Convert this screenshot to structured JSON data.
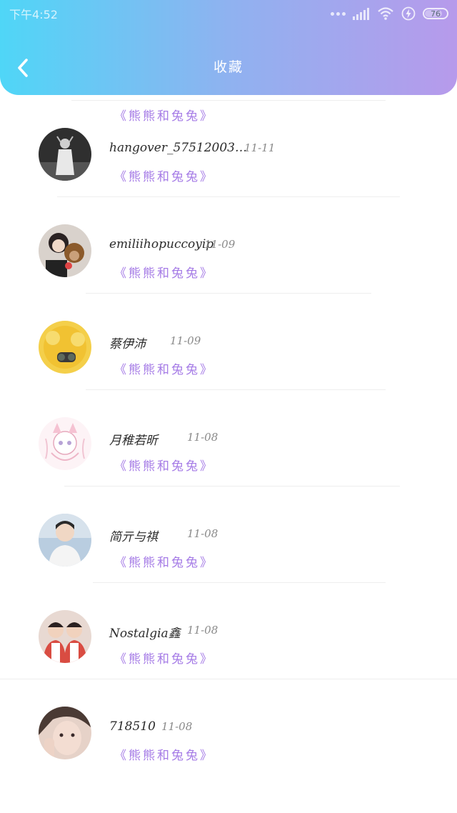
{
  "status_bar": {
    "time": "下午4:52",
    "battery": "76",
    "icons": [
      "signal-icon",
      "wifi-icon",
      "charging-icon",
      "battery-icon"
    ]
  },
  "header": {
    "title": "收藏",
    "back_icon": "chevron-left-icon",
    "gradient": [
      "#4fd6f7",
      "#b79aeb"
    ]
  },
  "tag_color": "#a57be6",
  "items": [
    {
      "name": "",
      "date": "",
      "tag": "《熊熊和兔兔》",
      "avatar_color": "#e8dccb"
    },
    {
      "name": "hangover_57512003…",
      "date": "11-11",
      "tag": "《熊熊和兔兔》",
      "avatar_color": "#3b3b3b"
    },
    {
      "name": "emiliihopuccoyip",
      "date": "11-09",
      "tag": "《熊熊和兔兔》",
      "avatar_color": "#5a4a44"
    },
    {
      "name": "蔡伊沛",
      "date": "11-09",
      "tag": "《熊熊和兔兔》",
      "avatar_color": "#f0c43c"
    },
    {
      "name": "月稚若昕",
      "date": "11-08",
      "tag": "《熊熊和兔兔》",
      "avatar_color": "#fbe7ee"
    },
    {
      "name": "简亓与祺",
      "date": "11-08",
      "tag": "《熊熊和兔兔》",
      "avatar_color": "#c9d7e4"
    },
    {
      "name": "Nostalgia鑫",
      "date": "11-08",
      "tag": "《熊熊和兔兔》",
      "avatar_color": "#d8584e"
    },
    {
      "name": "718510",
      "date": "11-08",
      "tag": "《熊熊和兔兔》",
      "avatar_color": "#e7d3cb"
    }
  ]
}
